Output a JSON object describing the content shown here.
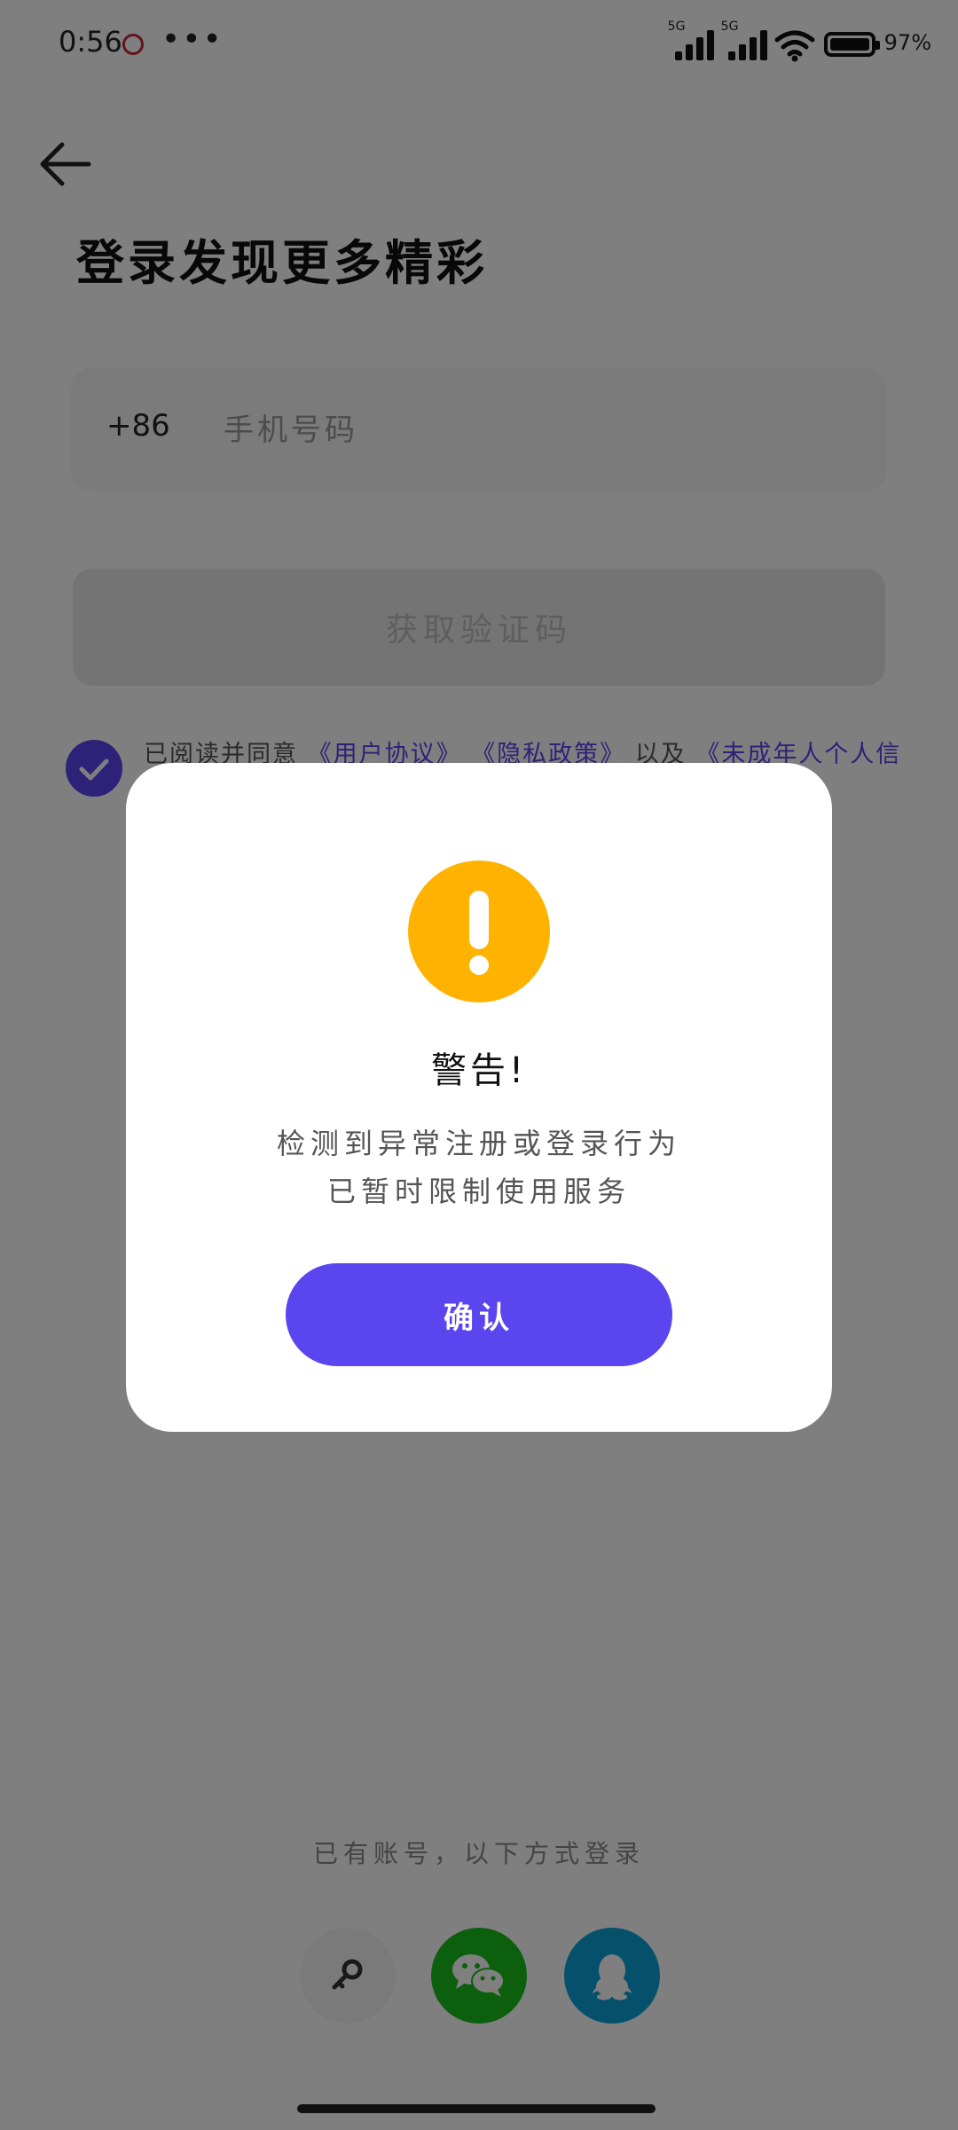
{
  "status_bar": {
    "time": "0:56",
    "signal1_label": "5G",
    "signal2_label": "5G",
    "battery_percent": "97%"
  },
  "header": {
    "title": "登录发现更多精彩"
  },
  "phone": {
    "country_code": "+86",
    "placeholder": "手机号码"
  },
  "get_code_button": "获取验证码",
  "agreement": {
    "prefix": "已阅读并同意",
    "user_agreement": "《用户协议》",
    "privacy_policy": "《隐私政策》",
    "connector": "以及",
    "minor_policy": "《未成年人个人信"
  },
  "other_login": {
    "label": "已有账号，以下方式登录",
    "methods": [
      "key-icon",
      "wechat-icon",
      "qq-icon"
    ]
  },
  "dialog": {
    "title": "警告!",
    "message_line1": "检测到异常注册或登录行为",
    "message_line2": "已暂时限制使用服务",
    "confirm_label": "确认"
  },
  "colors": {
    "accent": "#5b45ef",
    "warning": "#ffb300",
    "wechat": "#19bf18",
    "qq": "#0aa2d6"
  }
}
